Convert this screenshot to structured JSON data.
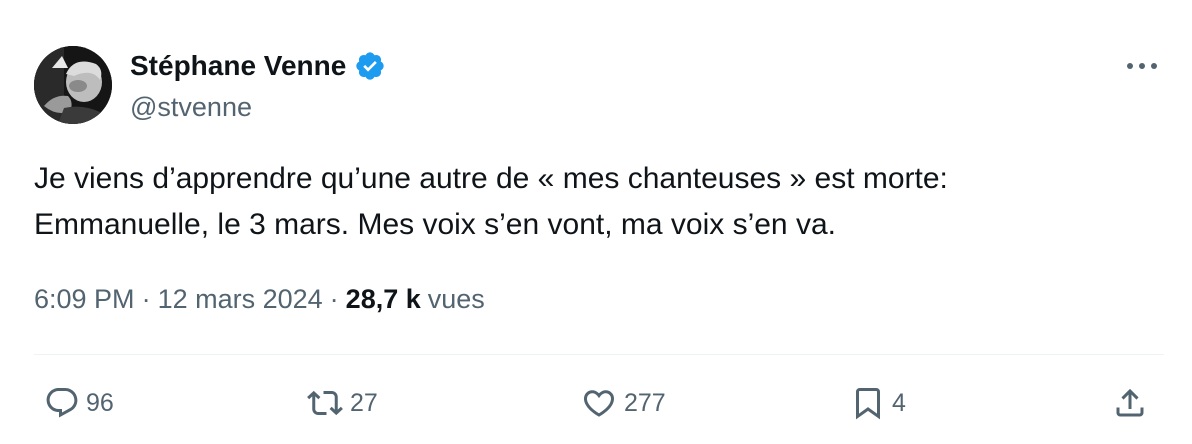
{
  "author": {
    "name": "Stéphane Venne",
    "handle": "@stvenne",
    "verified_icon": "verified-badge-icon",
    "verified_color": "#1d9bf0"
  },
  "tweet": {
    "text_lines": [
      "Je viens d’apprendre qu’une autre de « mes chanteuses » est morte:",
      "Emmanuelle, le 3 mars. Mes voix s’en vont, ma voix s’en va."
    ],
    "time": "6:09 PM",
    "date": "12 mars 2024",
    "separator": "·",
    "views_count": "28,7 k",
    "views_label": "vues"
  },
  "actions": {
    "reply": {
      "icon": "reply-icon",
      "count": "96"
    },
    "retweet": {
      "icon": "retweet-icon",
      "count": "27"
    },
    "like": {
      "icon": "heart-icon",
      "count": "277"
    },
    "bookmark": {
      "icon": "bookmark-icon",
      "count": "4"
    },
    "share": {
      "icon": "share-icon"
    }
  },
  "more_menu": {
    "icon": "more-horizontal-icon"
  },
  "colors": {
    "text_primary": "#0f1419",
    "text_secondary": "#536471",
    "divider": "#eff3f4"
  }
}
